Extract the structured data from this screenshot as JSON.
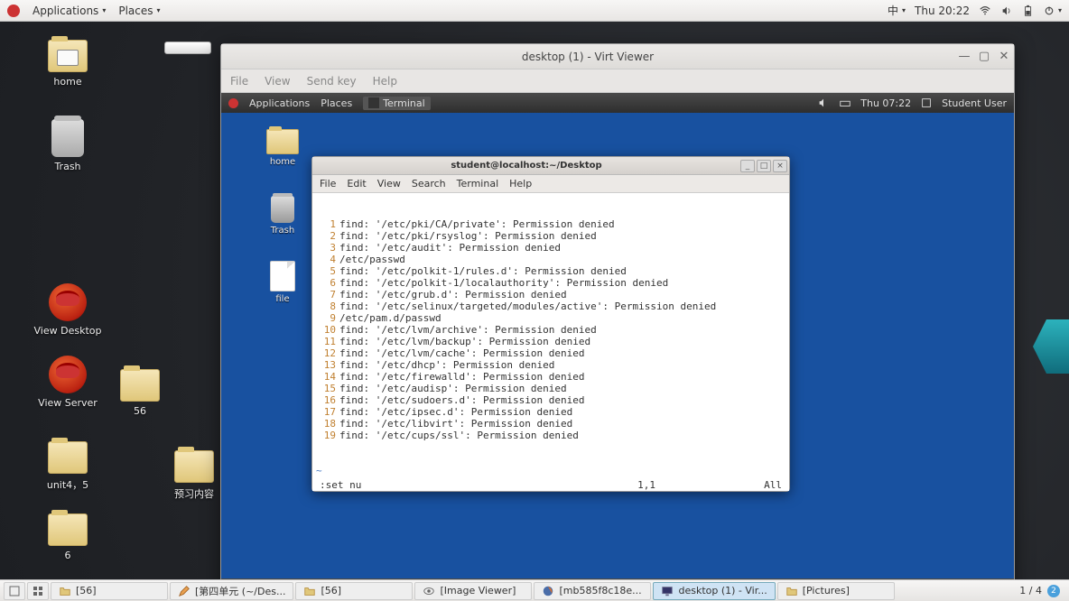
{
  "outer_panel": {
    "applications": "Applications",
    "places": "Places",
    "lang": "中",
    "clock": "Thu 20:22"
  },
  "outer_icons": {
    "home": "home",
    "trash": "Trash",
    "view_desktop": "View Desktop",
    "view_server": "View Server",
    "f56": "56",
    "unit45": "unit4，5",
    "preview": "预习内容",
    "f6": "6"
  },
  "vv": {
    "title": "desktop (1) - Virt Viewer",
    "menu": {
      "file": "File",
      "view": "View",
      "send": "Send key",
      "help": "Help"
    }
  },
  "guest_panel": {
    "applications": "Applications",
    "places": "Places",
    "terminal_tab": "Terminal",
    "clock": "Thu 07:22",
    "user": "Student User"
  },
  "guest_icons": {
    "home": "home",
    "trash": "Trash",
    "file": "file"
  },
  "term": {
    "title": "student@localhost:~/Desktop",
    "menu": {
      "file": "File",
      "edit": "Edit",
      "view": "View",
      "search": "Search",
      "terminal": "Terminal",
      "help": "Help"
    },
    "lines": [
      "find: '/etc/pki/CA/private': Permission denied",
      "find: '/etc/pki/rsyslog': Permission denied",
      "find: '/etc/audit': Permission denied",
      "/etc/passwd",
      "find: '/etc/polkit-1/rules.d': Permission denied",
      "find: '/etc/polkit-1/localauthority': Permission denied",
      "find: '/etc/grub.d': Permission denied",
      "find: '/etc/selinux/targeted/modules/active': Permission denied",
      "/etc/pam.d/passwd",
      "find: '/etc/lvm/archive': Permission denied",
      "find: '/etc/lvm/backup': Permission denied",
      "find: '/etc/lvm/cache': Permission denied",
      "find: '/etc/dhcp': Permission denied",
      "find: '/etc/firewalld': Permission denied",
      "find: '/etc/audisp': Permission denied",
      "find: '/etc/sudoers.d': Permission denied",
      "find: '/etc/ipsec.d': Permission denied",
      "find: '/etc/libvirt': Permission denied",
      "find: '/etc/cups/ssl': Permission denied"
    ],
    "status_cmd": ":set nu",
    "status_pos": "1,1",
    "status_pct": "All"
  },
  "guest_task": {
    "active": "student@localhost:~/Desktop",
    "ws": "1 / 4"
  },
  "outer_task": {
    "items": [
      {
        "icon": "folder",
        "label": "[56]"
      },
      {
        "icon": "pencil",
        "label": "[第四单元 (~/Des..."
      },
      {
        "icon": "folder",
        "label": "[56]"
      },
      {
        "icon": "eye",
        "label": "[Image Viewer]"
      },
      {
        "icon": "firefox",
        "label": "[mb585f8c18e..."
      },
      {
        "icon": "monitor",
        "label": "desktop (1) - Vir...",
        "active": true
      },
      {
        "icon": "folder",
        "label": "[Pictures]"
      }
    ],
    "ws": "1 / 4"
  }
}
